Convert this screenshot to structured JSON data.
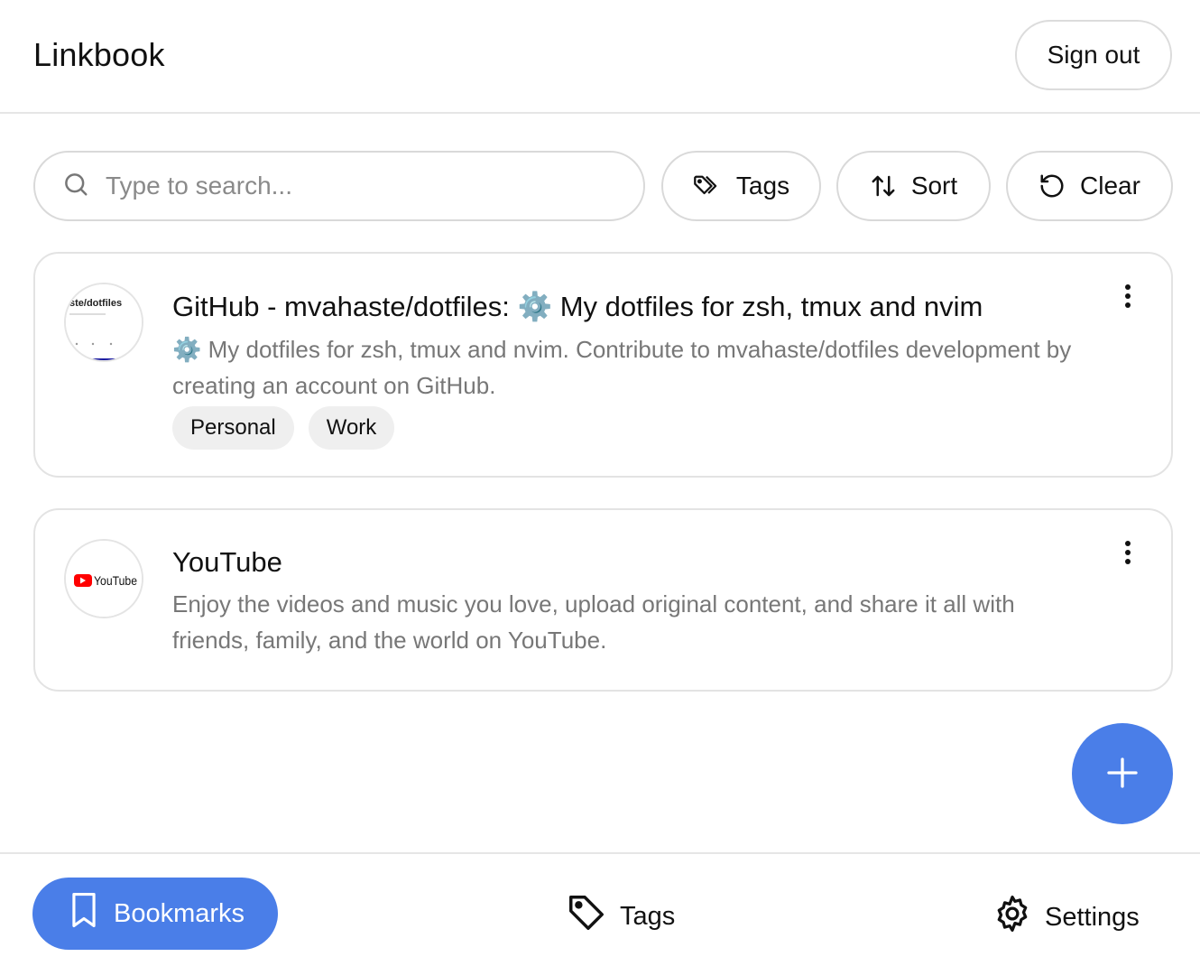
{
  "header": {
    "title": "Linkbook",
    "sign_out_label": "Sign out"
  },
  "toolbar": {
    "search_placeholder": "Type to search...",
    "tags_label": "Tags",
    "sort_label": "Sort",
    "clear_label": "Clear"
  },
  "bookmarks": [
    {
      "title": "GitHub - mvahaste/dotfiles: ⚙️ My dotfiles for zsh, tmux and nvim",
      "description": "⚙️ My dotfiles for zsh, tmux and nvim. Contribute to mvahaste/dotfiles development by creating an account on GitHub.",
      "favicon_text": "ste/dotfiles",
      "tags": [
        "Personal",
        "Work"
      ]
    },
    {
      "title": "YouTube",
      "description": "Enjoy the videos and music you love, upload original content, and share it all with friends, family, and the world on YouTube.",
      "favicon_text": "YouTube",
      "tags": []
    }
  ],
  "fab": {
    "icon": "plus-icon"
  },
  "nav": {
    "bookmarks_label": "Bookmarks",
    "tags_label": "Tags",
    "settings_label": "Settings"
  },
  "colors": {
    "accent": "#4a7ee8",
    "youtube_red": "#ff0000"
  }
}
